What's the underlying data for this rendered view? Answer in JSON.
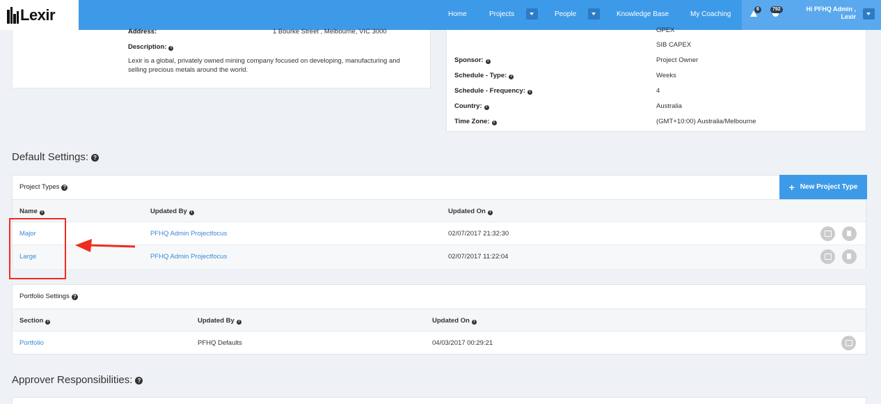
{
  "nav": {
    "logo": "Lexir",
    "home": "Home",
    "projects": "Projects",
    "people": "People",
    "knowledge_base": "Knowledge Base",
    "my_coaching": "My Coaching",
    "alerts_count": "6",
    "notifications_count": "792",
    "user_line1": "Hi PFHQ Admin ,",
    "user_line2": "Lexir"
  },
  "company": {
    "address_label": "Address:",
    "address_value": "1 Bourke Street , Melbourne, VIC 3000",
    "description_label": "Description:",
    "description_text": "Lexir is a global, privately owned mining company focused on developing, manufacturing and selling precious metals around the world."
  },
  "details": {
    "opex": "OPEX",
    "sib_capex": "SIB CAPEX",
    "rows": [
      {
        "label": "Sponsor:",
        "value": "Project Owner"
      },
      {
        "label": "Schedule - Type:",
        "value": "Weeks"
      },
      {
        "label": "Schedule - Frequency:",
        "value": "4"
      },
      {
        "label": "Country:",
        "value": "Australia"
      },
      {
        "label": "Time Zone:",
        "value": "(GMT+10:00) Australia/Melbourne"
      }
    ]
  },
  "default_settings": {
    "title": "Default Settings:",
    "project_types": {
      "title": "Project Types",
      "new_button": "New Project Type",
      "col_name": "Name",
      "col_updated_by": "Updated By",
      "col_updated_on": "Updated On",
      "rows": [
        {
          "name": "Major",
          "updated_by": "PFHQ Admin Projectfocus",
          "updated_on": "02/07/2017 21:32:30"
        },
        {
          "name": "Large",
          "updated_by": "PFHQ Admin Projectfocus",
          "updated_on": "02/07/2017 11:22:04"
        }
      ]
    },
    "portfolio": {
      "title": "Portfolio Settings",
      "col_section": "Section",
      "col_updated_by": "Updated By",
      "col_updated_on": "Updated On",
      "rows": [
        {
          "section": "Portfolio",
          "updated_by": "PFHQ Defaults",
          "updated_on": "04/03/2017 00:29:21"
        }
      ]
    }
  },
  "approver": {
    "title": "Approver Responsibilities:"
  },
  "colors": {
    "nav_bg": "#3d9ae8",
    "link": "#3a88d8",
    "highlight": "#f02b1f"
  }
}
